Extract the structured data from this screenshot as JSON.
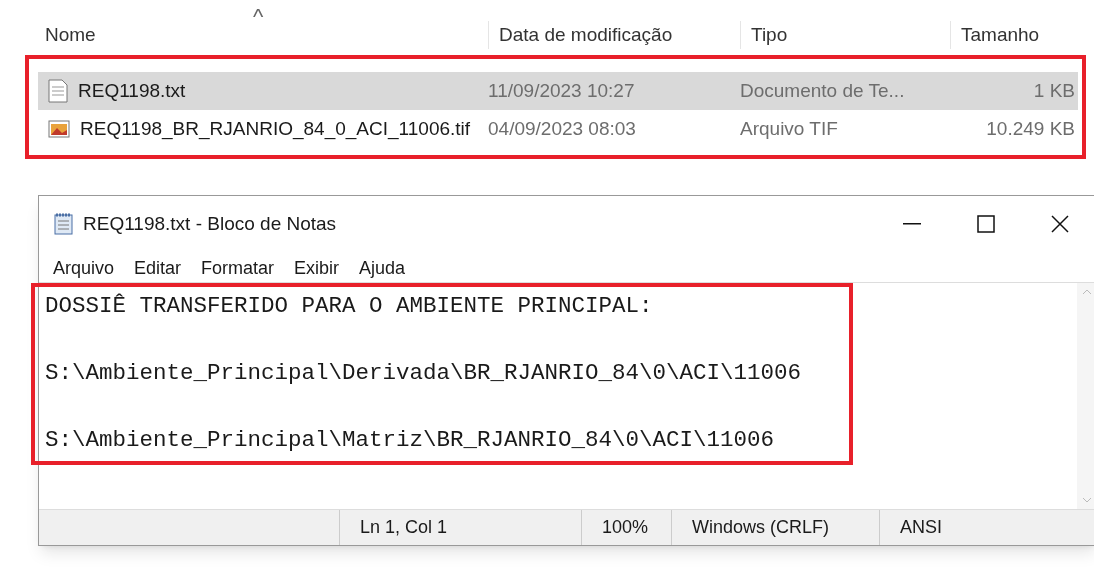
{
  "explorer": {
    "sort_indicator": "^",
    "columns": [
      "Nome",
      "Data de modificação",
      "Tipo",
      "Tamanho"
    ],
    "rows": [
      {
        "kind": "text",
        "name": "REQ1198.txt",
        "modified": "11/09/2023 10:27",
        "type": "Documento de Te...",
        "size": "1 KB",
        "selected": true
      },
      {
        "kind": "image",
        "name": "REQ1198_BR_RJANRIO_84_0_ACI_11006.tif",
        "modified": "04/09/2023 08:03",
        "type": "Arquivo TIF",
        "size": "10.249 KB",
        "selected": false
      }
    ]
  },
  "notepad": {
    "title": "REQ1198.txt - Bloco de Notas",
    "menu": [
      "Arquivo",
      "Editar",
      "Formatar",
      "Exibir",
      "Ajuda"
    ],
    "lines": [
      "DOSSIÊ TRANSFERIDO PARA O AMBIENTE PRINCIPAL:",
      "S:\\Ambiente_Principal\\Derivada\\BR_RJANRIO_84\\0\\ACI\\11006",
      "S:\\Ambiente_Principal\\Matriz\\BR_RJANRIO_84\\0\\ACI\\11006"
    ],
    "status_bar": [
      "Ln 1, Col 1",
      "100%",
      "Windows (CRLF)",
      "ANSI"
    ]
  }
}
